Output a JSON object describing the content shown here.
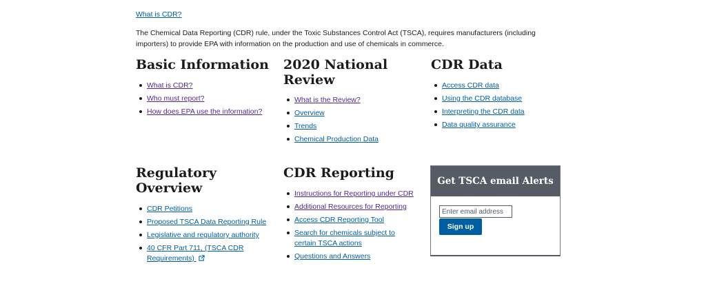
{
  "top_link": "What is CDR?",
  "intro": "The Chemical Data Reporting (CDR) rule, under the Toxic Substances Control Act (TSCA), requires manufacturers (including importers) to provide EPA with information on the production and use of chemicals in commerce.",
  "sections": {
    "basic": {
      "title": "Basic Information",
      "items": [
        "What is CDR?",
        "Who must report?",
        "How does EPA use the information?"
      ]
    },
    "review": {
      "title_line1": "2020 National",
      "title_line2": "Review",
      "items": [
        "What is the Review?",
        "Overview",
        "Trends",
        "Chemical Production Data"
      ]
    },
    "data": {
      "title": "CDR Data",
      "items": [
        "Access CDR data",
        "Using the CDR database",
        "Interpreting the CDR data",
        "Data quality assurance"
      ]
    },
    "regulatory": {
      "title": "Regulatory Overview",
      "items": [
        "CDR Petitions",
        "Proposed TSCA Data Reporting Rule",
        "Legislative and regulatory authority"
      ],
      "ext_line1": "40 CFR Part 711, (TSCA CDR",
      "ext_line2": "Requirements)"
    },
    "reporting": {
      "title": "CDR Reporting",
      "items": [
        "Instructions for Reporting under CDR",
        "Additional Resources for Reporting",
        "Access CDR Reporting Tool"
      ],
      "search_line1": "Search for chemicals subject to",
      "search_line2": "certain TSCA actions",
      "last_item": "Questions and Answers"
    }
  },
  "alerts": {
    "title": "Get TSCA email Alerts",
    "placeholder": "Enter email address",
    "button": "Sign up"
  },
  "colors": {
    "link": "#005ea2",
    "visited": "#54278f",
    "alert_header": "#565c65",
    "button": "#005ea2"
  },
  "icons": [
    "external-link-icon"
  ]
}
